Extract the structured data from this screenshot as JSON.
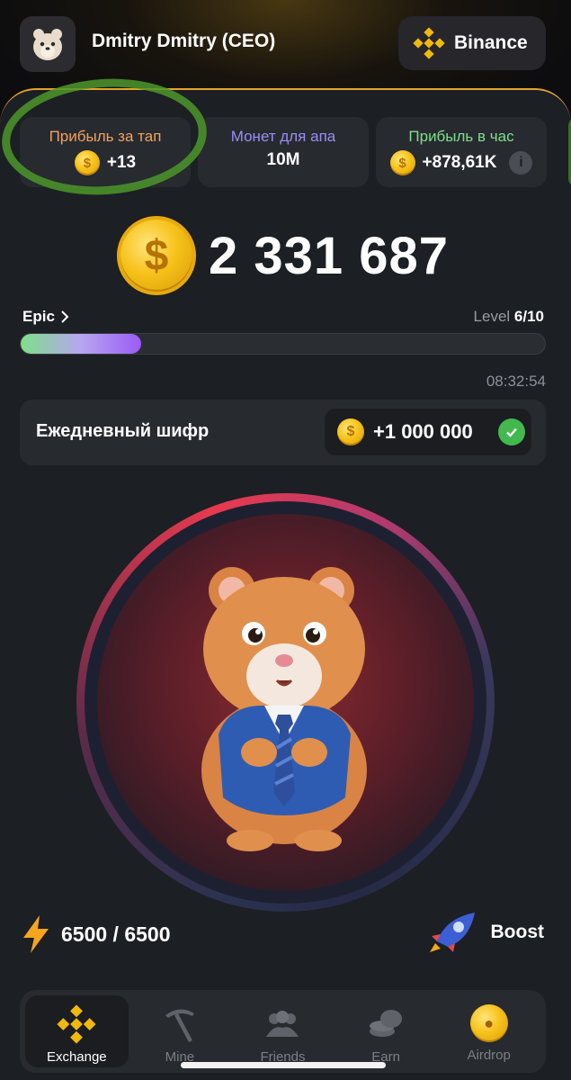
{
  "header": {
    "username": "Dmitry Dmitry (CEO)",
    "exchange_button": "Binance",
    "avatar_icon": "hamster-avatar-icon",
    "exchange_icon": "binance-logo-icon"
  },
  "stats": [
    {
      "title": "Прибыль за тап",
      "value": "+13",
      "color": "#f5a15c",
      "has_coin": true
    },
    {
      "title": "Монет для апа",
      "value": "10M",
      "color": "#9d8df5",
      "has_coin": false
    },
    {
      "title": "Прибыль в час",
      "value": "+878,61K",
      "color": "#7de08c",
      "has_coin": true
    }
  ],
  "balance": {
    "value": "2 331 687"
  },
  "level": {
    "name": "Epic",
    "label": "Level",
    "value": "6/10",
    "progress": 0.23
  },
  "timer": "08:32:54",
  "daily_cipher": {
    "label": "Ежедневный шифр",
    "reward": "+1 000 000",
    "completed": true
  },
  "energy": {
    "value": "6500 / 6500"
  },
  "boost": {
    "label": "Boost"
  },
  "nav": {
    "items": [
      {
        "label": "Exchange",
        "icon": "binance-icon",
        "active": true
      },
      {
        "label": "Mine",
        "icon": "pickaxe-icon",
        "active": false
      },
      {
        "label": "Friends",
        "icon": "friends-icon",
        "active": false
      },
      {
        "label": "Earn",
        "icon": "coins-stack-icon",
        "active": false
      },
      {
        "label": "Airdrop",
        "icon": "hamster-coin-icon",
        "active": false
      }
    ]
  },
  "colors": {
    "accent_gold": "#e6a52a",
    "background": "#1c1f24",
    "card": "#272a2f",
    "highlight_circle": "#4c962a"
  }
}
